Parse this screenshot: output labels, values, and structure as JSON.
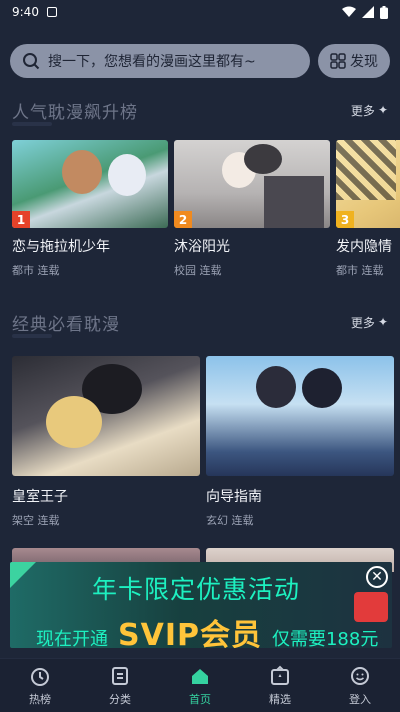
{
  "status": {
    "time": "9:40"
  },
  "search": {
    "placeholder": "搜一下，您想看的漫画这里都有~"
  },
  "discover": {
    "label": "发现"
  },
  "section1": {
    "title": "人气耽漫飙升榜",
    "more": "更多",
    "items": [
      {
        "rank": "1",
        "title": "恋与拖拉机少年",
        "meta": "都市 连载",
        "rank_color": "#e5422a"
      },
      {
        "rank": "2",
        "title": "沐浴阳光",
        "meta": "校园 连载",
        "rank_color": "#f08a1f"
      },
      {
        "rank": "3",
        "title": "发内隐情",
        "meta": "都市 连载",
        "rank_color": "#f0b21f"
      }
    ]
  },
  "section2": {
    "title": "经典必看耽漫",
    "more": "更多",
    "items": [
      {
        "title": "皇室王子",
        "meta": "架空 连载"
      },
      {
        "title": "向导指南",
        "meta": "玄幻 连载"
      }
    ]
  },
  "banner": {
    "line1": "年卡限定优惠活动",
    "line2a": "现在开通",
    "line2b": "SVIP会员",
    "line2c": "仅需要188元"
  },
  "tabs": [
    {
      "label": "热榜",
      "icon": "hot-icon"
    },
    {
      "label": "分类",
      "icon": "category-icon"
    },
    {
      "label": "首页",
      "icon": "home-icon"
    },
    {
      "label": "精选",
      "icon": "featured-icon"
    },
    {
      "label": "登入",
      "icon": "login-icon"
    }
  ]
}
